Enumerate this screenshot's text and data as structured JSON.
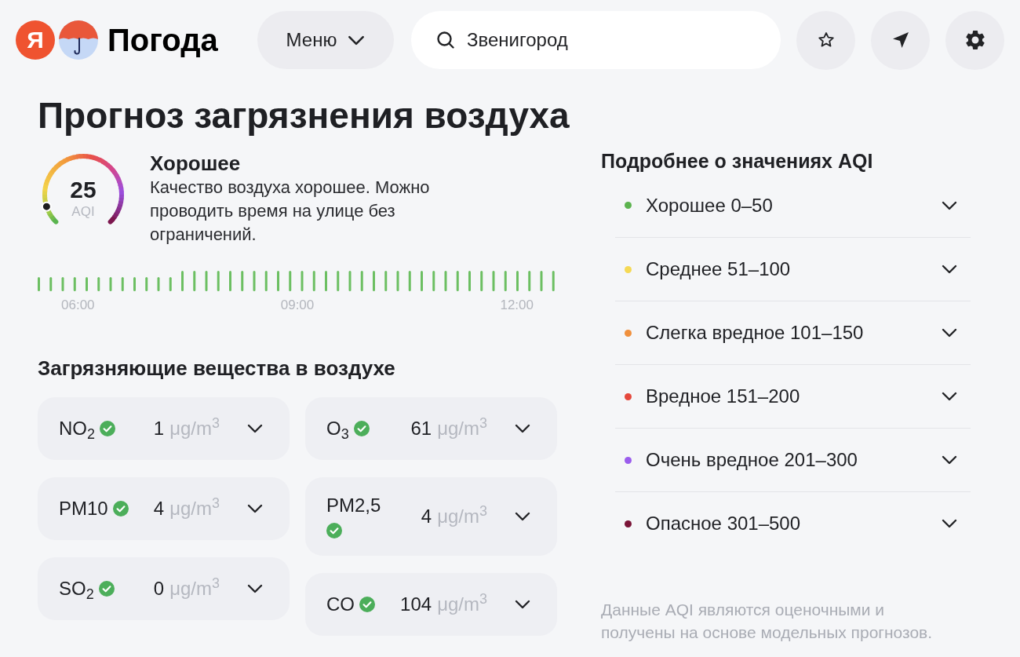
{
  "header": {
    "logo": {
      "letter": "Я",
      "title": "Погода"
    },
    "menu_button": {
      "label": "Меню"
    },
    "search": {
      "value": "Звенигород"
    }
  },
  "page_title": "Прогноз загрязнения воздуха",
  "air_quality": {
    "aqi": "25",
    "unit": "AQI",
    "level": 0.1,
    "label": "Хорошее",
    "description": "Качество воздуха хорошее. Можно проводить время на улице без ограничений."
  },
  "timeline": {
    "labels": [
      "06:00",
      "09:00",
      "12:00"
    ]
  },
  "pollutants": {
    "heading": "Загрязняющие вещества в воздухе",
    "items": [
      {
        "name": "NO$_{2}$",
        "within_norm": true,
        "value": "1",
        "unit": "μg/m$^{3}$",
        "expanded": false
      },
      {
        "name": "O$_{3}$",
        "within_norm": true,
        "value": "61",
        "unit": "μg/m$^{3}$",
        "expanded": false
      },
      {
        "name": "PM10",
        "within_norm": true,
        "value": "4",
        "unit": "μg/m$^{3}$",
        "expanded": false
      },
      {
        "name": "PM2,5",
        "within_norm": true,
        "value": "4",
        "unit": "μg/m$^{3}$",
        "expanded": false
      },
      {
        "name": "SO$_{2}$",
        "within_norm": true,
        "value": "0",
        "unit": "μg/m$^{3}$",
        "expanded": false
      },
      {
        "name": "CO",
        "within_norm": true,
        "value": "104",
        "unit": "μg/m$^{3}$",
        "expanded": false
      }
    ]
  },
  "aqi_scale": {
    "heading": "Подробнее о значениях AQI",
    "items": [
      {
        "label": "Хорошее 0–50",
        "color": "#5cb34f",
        "expanded": false
      },
      {
        "label": "Среднее 51–100",
        "color": "#f5d955",
        "expanded": false
      },
      {
        "label": "Слегка вредное 101–150",
        "color": "#f0903d",
        "expanded": false
      },
      {
        "label": "Вредное 151–200",
        "color": "#e5483c",
        "expanded": false
      },
      {
        "label": "Очень вредное 201–300",
        "color": "#9b5ded",
        "expanded": false
      },
      {
        "label": "Опасное 301–500",
        "color": "#7a1538",
        "expanded": false
      }
    ]
  },
  "footnote": "Данные AQI являются оценочными и получены на основе модельных прогнозов."
}
